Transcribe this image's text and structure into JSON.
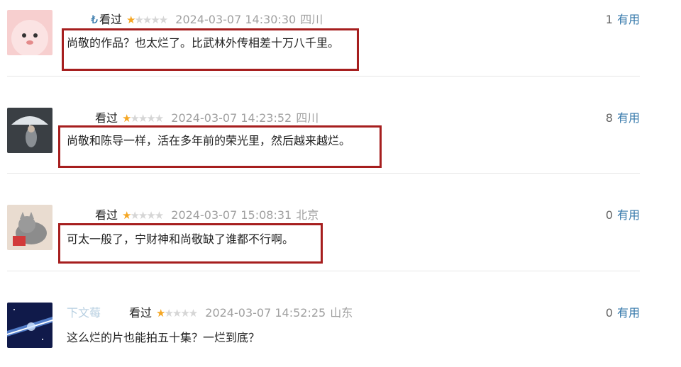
{
  "reviews": [
    {
      "username": "₺",
      "status": "看过",
      "rating": 1,
      "time": "2024-03-07 14:30:30",
      "location": "四川",
      "votes": "1",
      "useful_label": "有用",
      "content": "尚敬的作品？也太烂了。比武林外传相差十万八千里。",
      "highlighted": true,
      "avatar": "pink-cartoon-avatar"
    },
    {
      "username": "",
      "status": "看过",
      "rating": 1,
      "time": "2024-03-07 14:23:52",
      "location": "四川",
      "votes": "8",
      "useful_label": "有用",
      "content": "尚敬和陈导一样，活在多年前的荣光里，然后越来越烂。",
      "highlighted": true,
      "avatar": "umbrella-photo-avatar"
    },
    {
      "username": "",
      "status": "看过",
      "rating": 1,
      "time": "2024-03-07 15:08:31",
      "location": "北京",
      "votes": "0",
      "useful_label": "有用",
      "content": "可太一般了，宁财神和尚敬缺了谁都不行啊。",
      "highlighted": true,
      "avatar": "cat-photo-avatar"
    },
    {
      "username": "下文莓",
      "status": "看过",
      "rating": 1,
      "time": "2024-03-07 14:52:25",
      "location": "山东",
      "votes": "0",
      "useful_label": "有用",
      "content": "这么烂的片也能拍五十集？一烂到底？",
      "highlighted": false,
      "avatar": "space-light-avatar"
    }
  ],
  "colors": {
    "link": "#3377aa",
    "star": "#f5a623",
    "highlight_border": "#a61e1e",
    "meta_gray": "#a0a0a0"
  }
}
